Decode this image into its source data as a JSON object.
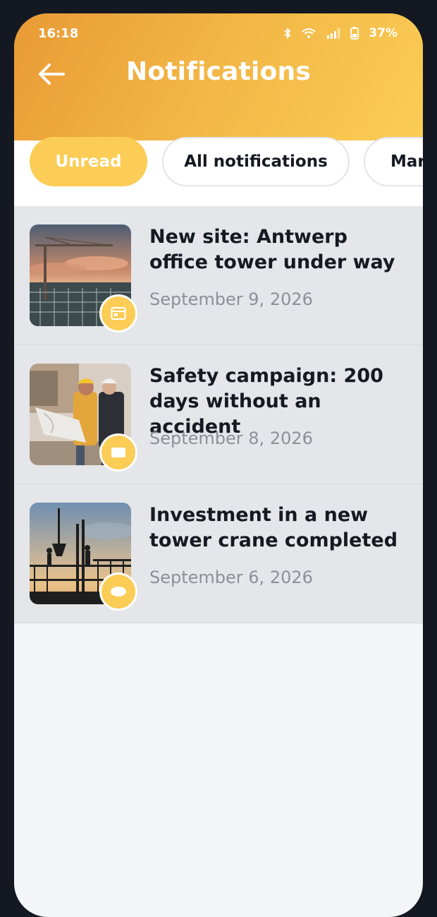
{
  "status_bar": {
    "time": "16:18",
    "battery": "37%"
  },
  "header": {
    "title": "Notifications"
  },
  "tabs": [
    {
      "label": "Unread",
      "active": true
    },
    {
      "label": "All notifications",
      "active": false
    },
    {
      "label": "Mar",
      "active": false
    }
  ],
  "notifications": [
    {
      "title": "New site: Antwerp office tower under way",
      "date": "September 9, 2026",
      "badge_icon": "calendar-icon"
    },
    {
      "title": "Safety campaign: 200 days without an accident",
      "date": "September 8, 2026",
      "badge_icon": "message-icon"
    },
    {
      "title": "Investment in a new tower crane completed",
      "date": "September 6, 2026",
      "badge_icon": "eye-icon"
    }
  ],
  "colors": {
    "accent": "#fbcd56",
    "header_start": "#e89a35",
    "text_dark": "#151922",
    "text_muted": "#8d9099"
  }
}
